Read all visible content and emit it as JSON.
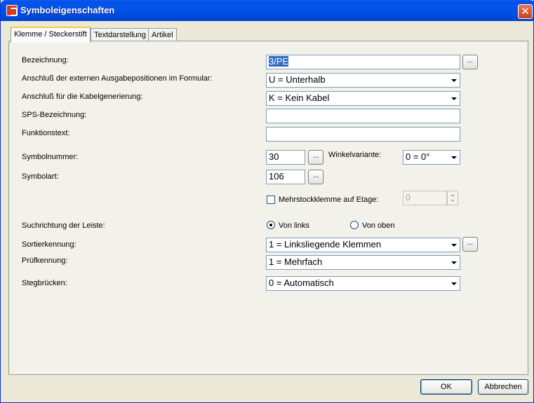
{
  "window": {
    "title": "Symboleigenschaften",
    "close_label": "✕"
  },
  "tabs": [
    {
      "label": "Klemme / Steckerstift",
      "active": true
    },
    {
      "label": "Textdarstellung",
      "active": false
    },
    {
      "label": "Artikel",
      "active": false
    }
  ],
  "form": {
    "bezeichnung": {
      "label": "Bezeichnung:",
      "value": "3/PE",
      "button": "..."
    },
    "anschluss_ausgabe": {
      "label": "Anschluß der externen Ausgabepositionen im Formular:",
      "value": "U = Unterhalb"
    },
    "anschluss_kabel": {
      "label": "Anschluß für die Kabelgenerierung:",
      "value": "K = Kein Kabel"
    },
    "sps": {
      "label": "SPS-Bezeichnung:",
      "value": ""
    },
    "funktionstext": {
      "label": "Funktionstext:",
      "value": ""
    },
    "symbolnummer": {
      "label": "Symbolnummer:",
      "value": "30",
      "button": "..."
    },
    "winkelvariante": {
      "label": "Winkelvariante:",
      "value": "0 = 0°"
    },
    "symbolart": {
      "label": "Symbolart:",
      "value": "106",
      "button": "..."
    },
    "mehrstock": {
      "label": "Mehrstockklemme auf Etage:",
      "checked": false,
      "value": "0"
    },
    "suchrichtung": {
      "label": "Suchrichtung der Leiste:",
      "options": [
        {
          "label": "Von links",
          "selected": true
        },
        {
          "label": "Von oben",
          "selected": false
        }
      ]
    },
    "sortierkennung": {
      "label": "Sortierkennung:",
      "value": "1 = Linksliegende Klemmen",
      "button": "..."
    },
    "pruefkennung": {
      "label": "Prüfkennung:",
      "value": "1 = Mehrfach"
    },
    "stegbruecken": {
      "label": "Stegbrücken:",
      "value": "0 = Automatisch"
    }
  },
  "footer": {
    "ok_label": "OK",
    "cancel_label": "Abbrechen"
  }
}
